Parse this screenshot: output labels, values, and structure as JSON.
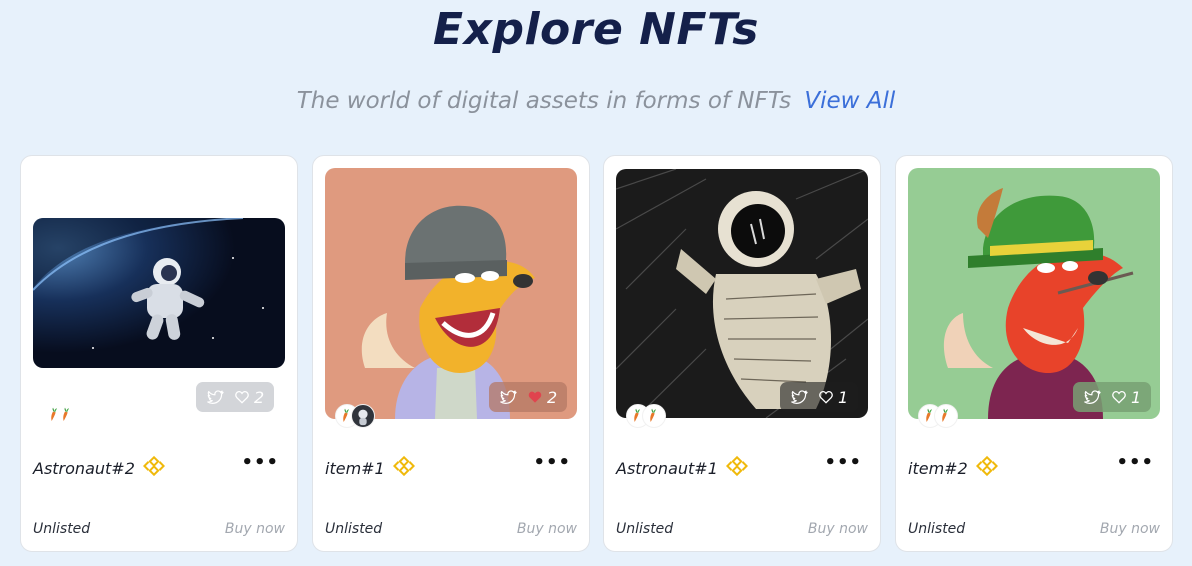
{
  "header": {
    "title": "Explore NFTs",
    "subtitle": "The world of digital assets in forms of NFTs",
    "view_all": "View All"
  },
  "colors": {
    "title": "#14204a",
    "accent": "#3b6fd9",
    "bnb_gold": "#f0b90b",
    "like_red": "#e0444e"
  },
  "cards": [
    {
      "name": "Astronaut#2",
      "chain_icon": "bnb-icon",
      "likes": "2",
      "liked": false,
      "status": "Unlisted",
      "action": "Buy now",
      "image": "astronaut-space-photo"
    },
    {
      "name": "item#1",
      "chain_icon": "bnb-icon",
      "likes": "2",
      "liked": true,
      "status": "Unlisted",
      "action": "Buy now",
      "image": "fox-beanie-illustration"
    },
    {
      "name": "Astronaut#1",
      "chain_icon": "bnb-icon",
      "likes": "1",
      "liked": false,
      "status": "Unlisted",
      "action": "Buy now",
      "image": "astronaut-sketch"
    },
    {
      "name": "item#2",
      "chain_icon": "bnb-icon",
      "likes": "1",
      "liked": false,
      "status": "Unlisted",
      "action": "Buy now",
      "image": "fox-hat-illustration"
    }
  ]
}
